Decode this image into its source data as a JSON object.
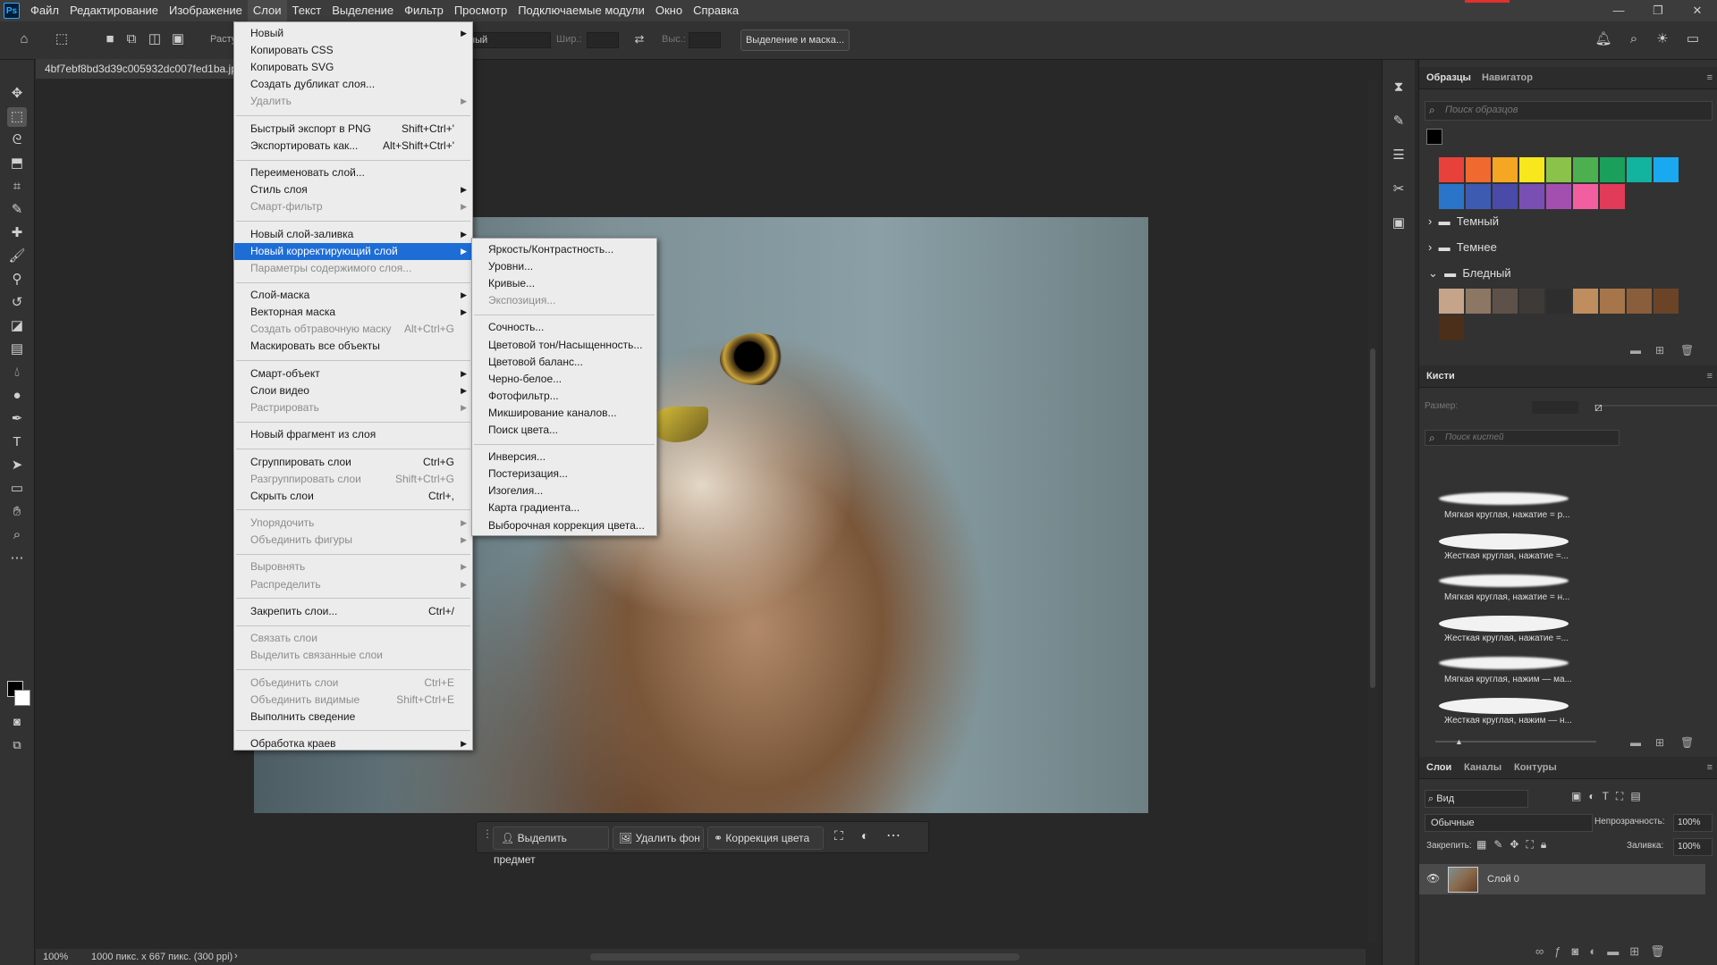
{
  "menubar": {
    "items": [
      "Файл",
      "Редактирование",
      "Изображение",
      "Слои",
      "Текст",
      "Выделение",
      "Фильтр",
      "Просмотр",
      "Подключаемые модули",
      "Окно",
      "Справка"
    ],
    "active": "Слои"
  },
  "options": {
    "rasterize_label": "Расту",
    "style_value": "ный",
    "width_label": "Шир.:",
    "height_label": "Выс.:",
    "select_mask_button": "Выделение и маска..."
  },
  "document": {
    "tab_title": "4bf7ebf8bd3d39c005932dc007fed1ba.jp",
    "zoom": "100%",
    "info": "1000 пикс. x 667 пикс. (300 ppi)"
  },
  "context_bar": {
    "select_subject": "Выделить предмет",
    "remove_bg": "Удалить фон",
    "color_correction": "Коррекция цвета"
  },
  "layer_menu": [
    {
      "label": "Новый",
      "arrow": true
    },
    {
      "label": "Копировать CSS"
    },
    {
      "label": "Копировать SVG"
    },
    {
      "label": "Создать дубликат слоя..."
    },
    {
      "label": "Удалить",
      "arrow": true,
      "disabled": true
    },
    {
      "sep": true
    },
    {
      "label": "Быстрый экспорт в PNG",
      "shortcut": "Shift+Ctrl+'"
    },
    {
      "label": "Экспортировать как...",
      "shortcut": "Alt+Shift+Ctrl+'"
    },
    {
      "sep": true
    },
    {
      "label": "Переименовать слой..."
    },
    {
      "label": "Стиль слоя",
      "arrow": true
    },
    {
      "label": "Смарт-фильтр",
      "arrow": true,
      "disabled": true
    },
    {
      "sep": true
    },
    {
      "label": "Новый слой-заливка",
      "arrow": true
    },
    {
      "label": "Новый корректирующий слой",
      "arrow": true,
      "highlighted": true
    },
    {
      "label": "Параметры содержимого слоя...",
      "disabled": true
    },
    {
      "sep": true
    },
    {
      "label": "Слой-маска",
      "arrow": true
    },
    {
      "label": "Векторная маска",
      "arrow": true
    },
    {
      "label": "Создать обтравочную маску",
      "shortcut": "Alt+Ctrl+G",
      "disabled": true
    },
    {
      "label": "Маскировать все объекты"
    },
    {
      "sep": true
    },
    {
      "label": "Смарт-объект",
      "arrow": true
    },
    {
      "label": "Слои видео",
      "arrow": true
    },
    {
      "label": "Растрировать",
      "arrow": true,
      "disabled": true
    },
    {
      "sep": true
    },
    {
      "label": "Новый фрагмент из слоя"
    },
    {
      "sep": true
    },
    {
      "label": "Сгруппировать слои",
      "shortcut": "Ctrl+G"
    },
    {
      "label": "Разгруппировать слои",
      "shortcut": "Shift+Ctrl+G",
      "disabled": true
    },
    {
      "label": "Скрыть слои",
      "shortcut": "Ctrl+,"
    },
    {
      "sep": true
    },
    {
      "label": "Упорядочить",
      "arrow": true,
      "disabled": true
    },
    {
      "label": "Объединить фигуры",
      "arrow": true,
      "disabled": true
    },
    {
      "sep": true
    },
    {
      "label": "Выровнять",
      "arrow": true,
      "disabled": true
    },
    {
      "label": "Распределить",
      "arrow": true,
      "disabled": true
    },
    {
      "sep": true
    },
    {
      "label": "Закрепить слои...",
      "shortcut": "Ctrl+/"
    },
    {
      "sep": true
    },
    {
      "label": "Связать слои",
      "disabled": true
    },
    {
      "label": "Выделить связанные слои",
      "disabled": true
    },
    {
      "sep": true
    },
    {
      "label": "Объединить слои",
      "shortcut": "Ctrl+E",
      "disabled": true
    },
    {
      "label": "Объединить видимые",
      "shortcut": "Shift+Ctrl+E",
      "disabled": true
    },
    {
      "label": "Выполнить сведение"
    },
    {
      "sep": true
    },
    {
      "label": "Обработка краев",
      "arrow": true
    }
  ],
  "adjust_submenu": [
    {
      "label": "Яркость/Контрастность..."
    },
    {
      "label": "Уровни..."
    },
    {
      "label": "Кривые..."
    },
    {
      "label": "Экспозиция...",
      "disabled": true
    },
    {
      "sep": true
    },
    {
      "label": "Сочность..."
    },
    {
      "label": "Цветовой тон/Насыщенность..."
    },
    {
      "label": "Цветовой баланс..."
    },
    {
      "label": "Черно-белое..."
    },
    {
      "label": "Фотофильтр..."
    },
    {
      "label": "Микширование каналов..."
    },
    {
      "label": "Поиск цвета..."
    },
    {
      "sep": true
    },
    {
      "label": "Инверсия..."
    },
    {
      "label": "Постеризация..."
    },
    {
      "label": "Изогелия..."
    },
    {
      "label": "Карта градиента..."
    },
    {
      "label": "Выборочная коррекция цвета..."
    }
  ],
  "swatches": {
    "tabs": [
      "Образцы",
      "Навигатор"
    ],
    "search_placeholder": "Поиск образцов",
    "row1": [
      "#e8413b",
      "#f06a2f",
      "#f5a623",
      "#f8e71c",
      "#8bc34a",
      "#4caf50",
      "#1aa05a",
      "#12b39f",
      "#19a9f0"
    ],
    "row2": [
      "#2a75c9",
      "#3d5bb0",
      "#4a4aa8",
      "#7a4fb3",
      "#a34fb0",
      "#f25fa0",
      "#e23b5a"
    ],
    "folders": [
      "Темный",
      "Темнее",
      "Бледный"
    ],
    "pale": [
      "#c5a48a",
      "#8c7664",
      "#5e514a",
      "#3e3a38",
      "#2e2e2e",
      "#c08d5e",
      "#a67549",
      "#8a5e3a",
      "#6b4428",
      "#4b2f1a"
    ]
  },
  "brushes": {
    "tab": "Кисти",
    "size_label": "Размер:",
    "search_placeholder": "Поиск кистей",
    "items": [
      "Мягкая круглая, нажатие = р...",
      "Жесткая круглая, нажатие =...",
      "Мягкая круглая, нажатие = н...",
      "Жесткая круглая, нажатие =...",
      "Мягкая круглая, нажим — ма...",
      "Жесткая круглая, нажим — н..."
    ]
  },
  "layers": {
    "tabs": [
      "Слои",
      "Каналы",
      "Контуры"
    ],
    "filter_label": "Вид",
    "blend_mode": "Обычные",
    "opacity_label": "Непрозрачность:",
    "opacity_value": "100%",
    "lock_label": "Закрепить:",
    "fill_label": "Заливка:",
    "fill_value": "100%",
    "layer_name": "Слой 0"
  }
}
